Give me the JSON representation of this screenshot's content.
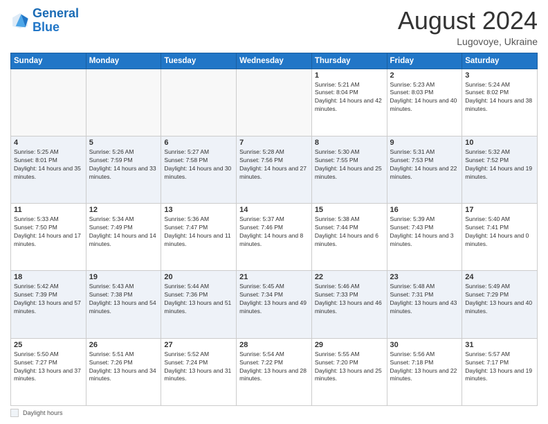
{
  "header": {
    "logo_general": "General",
    "logo_blue": "Blue",
    "month_year": "August 2024",
    "location": "Lugovoye, Ukraine"
  },
  "weekdays": [
    "Sunday",
    "Monday",
    "Tuesday",
    "Wednesday",
    "Thursday",
    "Friday",
    "Saturday"
  ],
  "footer": {
    "label": "Daylight hours"
  },
  "weeks": [
    [
      {
        "day": "",
        "sunrise": "",
        "sunset": "",
        "daylight": ""
      },
      {
        "day": "",
        "sunrise": "",
        "sunset": "",
        "daylight": ""
      },
      {
        "day": "",
        "sunrise": "",
        "sunset": "",
        "daylight": ""
      },
      {
        "day": "",
        "sunrise": "",
        "sunset": "",
        "daylight": ""
      },
      {
        "day": "1",
        "sunrise": "Sunrise: 5:21 AM",
        "sunset": "Sunset: 8:04 PM",
        "daylight": "Daylight: 14 hours and 42 minutes."
      },
      {
        "day": "2",
        "sunrise": "Sunrise: 5:23 AM",
        "sunset": "Sunset: 8:03 PM",
        "daylight": "Daylight: 14 hours and 40 minutes."
      },
      {
        "day": "3",
        "sunrise": "Sunrise: 5:24 AM",
        "sunset": "Sunset: 8:02 PM",
        "daylight": "Daylight: 14 hours and 38 minutes."
      }
    ],
    [
      {
        "day": "4",
        "sunrise": "Sunrise: 5:25 AM",
        "sunset": "Sunset: 8:01 PM",
        "daylight": "Daylight: 14 hours and 35 minutes."
      },
      {
        "day": "5",
        "sunrise": "Sunrise: 5:26 AM",
        "sunset": "Sunset: 7:59 PM",
        "daylight": "Daylight: 14 hours and 33 minutes."
      },
      {
        "day": "6",
        "sunrise": "Sunrise: 5:27 AM",
        "sunset": "Sunset: 7:58 PM",
        "daylight": "Daylight: 14 hours and 30 minutes."
      },
      {
        "day": "7",
        "sunrise": "Sunrise: 5:28 AM",
        "sunset": "Sunset: 7:56 PM",
        "daylight": "Daylight: 14 hours and 27 minutes."
      },
      {
        "day": "8",
        "sunrise": "Sunrise: 5:30 AM",
        "sunset": "Sunset: 7:55 PM",
        "daylight": "Daylight: 14 hours and 25 minutes."
      },
      {
        "day": "9",
        "sunrise": "Sunrise: 5:31 AM",
        "sunset": "Sunset: 7:53 PM",
        "daylight": "Daylight: 14 hours and 22 minutes."
      },
      {
        "day": "10",
        "sunrise": "Sunrise: 5:32 AM",
        "sunset": "Sunset: 7:52 PM",
        "daylight": "Daylight: 14 hours and 19 minutes."
      }
    ],
    [
      {
        "day": "11",
        "sunrise": "Sunrise: 5:33 AM",
        "sunset": "Sunset: 7:50 PM",
        "daylight": "Daylight: 14 hours and 17 minutes."
      },
      {
        "day": "12",
        "sunrise": "Sunrise: 5:34 AM",
        "sunset": "Sunset: 7:49 PM",
        "daylight": "Daylight: 14 hours and 14 minutes."
      },
      {
        "day": "13",
        "sunrise": "Sunrise: 5:36 AM",
        "sunset": "Sunset: 7:47 PM",
        "daylight": "Daylight: 14 hours and 11 minutes."
      },
      {
        "day": "14",
        "sunrise": "Sunrise: 5:37 AM",
        "sunset": "Sunset: 7:46 PM",
        "daylight": "Daylight: 14 hours and 8 minutes."
      },
      {
        "day": "15",
        "sunrise": "Sunrise: 5:38 AM",
        "sunset": "Sunset: 7:44 PM",
        "daylight": "Daylight: 14 hours and 6 minutes."
      },
      {
        "day": "16",
        "sunrise": "Sunrise: 5:39 AM",
        "sunset": "Sunset: 7:43 PM",
        "daylight": "Daylight: 14 hours and 3 minutes."
      },
      {
        "day": "17",
        "sunrise": "Sunrise: 5:40 AM",
        "sunset": "Sunset: 7:41 PM",
        "daylight": "Daylight: 14 hours and 0 minutes."
      }
    ],
    [
      {
        "day": "18",
        "sunrise": "Sunrise: 5:42 AM",
        "sunset": "Sunset: 7:39 PM",
        "daylight": "Daylight: 13 hours and 57 minutes."
      },
      {
        "day": "19",
        "sunrise": "Sunrise: 5:43 AM",
        "sunset": "Sunset: 7:38 PM",
        "daylight": "Daylight: 13 hours and 54 minutes."
      },
      {
        "day": "20",
        "sunrise": "Sunrise: 5:44 AM",
        "sunset": "Sunset: 7:36 PM",
        "daylight": "Daylight: 13 hours and 51 minutes."
      },
      {
        "day": "21",
        "sunrise": "Sunrise: 5:45 AM",
        "sunset": "Sunset: 7:34 PM",
        "daylight": "Daylight: 13 hours and 49 minutes."
      },
      {
        "day": "22",
        "sunrise": "Sunrise: 5:46 AM",
        "sunset": "Sunset: 7:33 PM",
        "daylight": "Daylight: 13 hours and 46 minutes."
      },
      {
        "day": "23",
        "sunrise": "Sunrise: 5:48 AM",
        "sunset": "Sunset: 7:31 PM",
        "daylight": "Daylight: 13 hours and 43 minutes."
      },
      {
        "day": "24",
        "sunrise": "Sunrise: 5:49 AM",
        "sunset": "Sunset: 7:29 PM",
        "daylight": "Daylight: 13 hours and 40 minutes."
      }
    ],
    [
      {
        "day": "25",
        "sunrise": "Sunrise: 5:50 AM",
        "sunset": "Sunset: 7:27 PM",
        "daylight": "Daylight: 13 hours and 37 minutes."
      },
      {
        "day": "26",
        "sunrise": "Sunrise: 5:51 AM",
        "sunset": "Sunset: 7:26 PM",
        "daylight": "Daylight: 13 hours and 34 minutes."
      },
      {
        "day": "27",
        "sunrise": "Sunrise: 5:52 AM",
        "sunset": "Sunset: 7:24 PM",
        "daylight": "Daylight: 13 hours and 31 minutes."
      },
      {
        "day": "28",
        "sunrise": "Sunrise: 5:54 AM",
        "sunset": "Sunset: 7:22 PM",
        "daylight": "Daylight: 13 hours and 28 minutes."
      },
      {
        "day": "29",
        "sunrise": "Sunrise: 5:55 AM",
        "sunset": "Sunset: 7:20 PM",
        "daylight": "Daylight: 13 hours and 25 minutes."
      },
      {
        "day": "30",
        "sunrise": "Sunrise: 5:56 AM",
        "sunset": "Sunset: 7:18 PM",
        "daylight": "Daylight: 13 hours and 22 minutes."
      },
      {
        "day": "31",
        "sunrise": "Sunrise: 5:57 AM",
        "sunset": "Sunset: 7:17 PM",
        "daylight": "Daylight: 13 hours and 19 minutes."
      }
    ]
  ]
}
